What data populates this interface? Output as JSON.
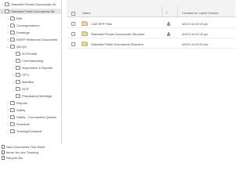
{
  "tree": {
    "items": [
      {
        "label": "Standard Private Documents UK",
        "depth": 0,
        "expanded": false,
        "selected": false
      },
      {
        "label": "Standard Public Documents Str",
        "depth": 0,
        "expanded": true,
        "selected": true
      },
      {
        "label": "BIM",
        "depth": 1,
        "expanded": false,
        "selected": false
      },
      {
        "label": "Correspondence",
        "depth": 1,
        "expanded": false,
        "selected": false
      },
      {
        "label": "Drawings",
        "depth": 1,
        "expanded": false,
        "selected": false
      },
      {
        "label": "EWFP Reference Documents",
        "depth": 1,
        "expanded": false,
        "selected": false
      },
      {
        "label": "QA-QC",
        "depth": 1,
        "expanded": true,
        "selected": false
      },
      {
        "label": "00 Permits",
        "depth": 2,
        "expanded": false,
        "selected": false
      },
      {
        "label": "Commissioning",
        "depth": 2,
        "expanded": false,
        "selected": false
      },
      {
        "label": "Inspections & Reports",
        "depth": 2,
        "expanded": false,
        "selected": false
      },
      {
        "label": "ITP's",
        "depth": 2,
        "expanded": false,
        "selected": false
      },
      {
        "label": "Manifest",
        "depth": 2,
        "expanded": false,
        "selected": false
      },
      {
        "label": "NCR",
        "depth": 2,
        "expanded": false,
        "selected": false
      },
      {
        "label": "Preparatory Meetings",
        "depth": 2,
        "expanded": false,
        "selected": false
      },
      {
        "label": "Reports",
        "depth": 1,
        "expanded": false,
        "selected": false
      },
      {
        "label": "Safety",
        "depth": 1,
        "expanded": false,
        "selected": false
      },
      {
        "label": "Safety - Coronavirus Questio",
        "depth": 1,
        "expanded": false,
        "selected": false
      },
      {
        "label": "Schedule",
        "depth": 1,
        "expanded": false,
        "selected": false
      },
      {
        "label": "Training/Onboardi",
        "depth": 1,
        "expanded": false,
        "selected": false
      }
    ]
  },
  "links": [
    {
      "label": "New Documents This Week"
    },
    {
      "label": "Items You Are Tracking"
    },
    {
      "label": "Recycle Bin"
    }
  ],
  "list": {
    "columns": {
      "name": "Name",
      "info": "i",
      "created": "Created for Latest Version"
    },
    "rows": [
      {
        "name": "C&E RFP Files",
        "locked": true,
        "date": "6/6/19 at 02:06 pm"
      },
      {
        "name": "Standard Private Documents Structure",
        "locked": true,
        "date": "6/6/19 at 02:06 pm"
      },
      {
        "name": "Standard Public Documents Structure",
        "locked": false,
        "date": "6/6/19 at 02:06 pm"
      }
    ]
  },
  "icons": {
    "chevron_collapsed": "chevron-right-icon",
    "chevron_expanded": "chevron-down-icon",
    "folder": "folder-icon",
    "lock": "lock-icon",
    "document": "document-icon"
  },
  "colors": {
    "selected_row": "#e6e6e6",
    "header_bg": "#f3f3f3",
    "folder_fill": "#e8d8a8"
  }
}
